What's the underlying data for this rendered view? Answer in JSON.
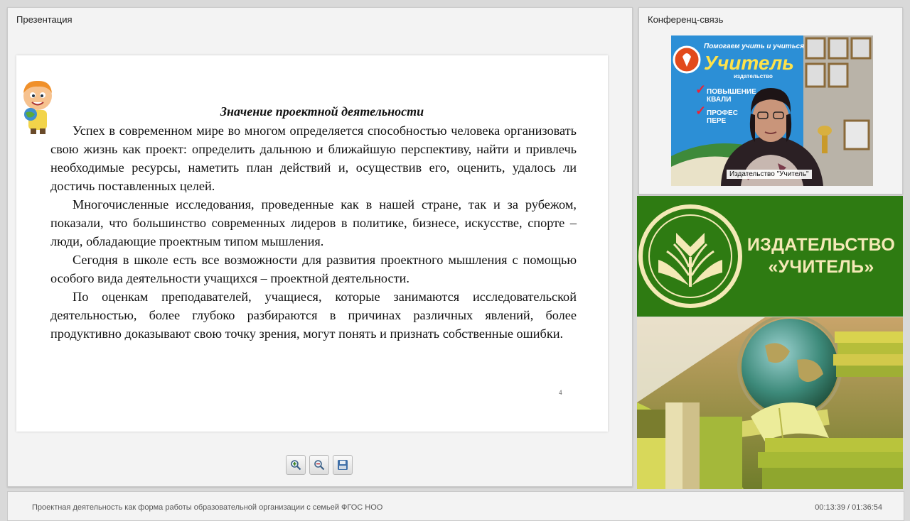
{
  "presentation": {
    "panel_title": "Презентация",
    "slide": {
      "heading": "Значение проектной деятельности",
      "paragraphs": [
        "Успех в современном мире во многом определяется способностью человека организовать свою жизнь как проект: определить дальнюю и ближайшую перспективу, найти и привлечь необходимые ресурсы, наметить план действий и, осуществив его, оценить, удалось ли достичь поставленных целей.",
        "Многочисленные исследования, проведенные как в нашей стране, так и за рубежом, показали, что большинство современных лидеров в политике, бизнесе, искусстве, спорте – люди, обладающие проектным типом мышления.",
        "Сегодня в школе есть все возможности для развития проектного мышления с помощью особого вида деятельности учащихся – проектной деятельности.",
        "По оценкам преподавателей, учащиеся, которые занимаются исследовательской деятельностью, более глубоко разбираются в причинах различных явлений, более продуктивно доказывают свою точку зрения, могут понять и признать собственные ошибки."
      ],
      "page_number": "4"
    },
    "toolbar": {
      "zoom_in_icon": "zoom-in-icon",
      "zoom_out_icon": "zoom-out-icon",
      "save_icon": "floppy-save-icon"
    }
  },
  "conference": {
    "panel_title": "Конференц-связь",
    "video_caption": "Издательство \"Учитель\"",
    "banner_lines": [
      "Помогаем учить и учиться",
      "Учитель",
      "издательство",
      "ПОВЫШЕНИЕ",
      "КВАЛИ",
      "ПРОФЕС",
      "ПЕРЕ"
    ]
  },
  "publisher_logo": {
    "line1": "ИЗДАТЕЛЬСТВО",
    "line2": "«УЧИТЕЛЬ»"
  },
  "footer": {
    "title": "Проектная деятельность как форма работы образовательной организации с семьей ФГОС НОО",
    "time": "00:13:39 / 01:36:54"
  },
  "colors": {
    "logo_green": "#2e7b12",
    "logo_text": "#f4e9b6"
  }
}
